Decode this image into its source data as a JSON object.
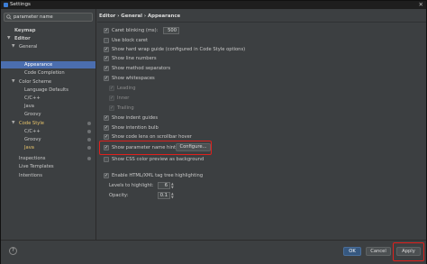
{
  "window": {
    "title": "Settings",
    "close_glyph": "✕"
  },
  "search": {
    "value": "parameter name"
  },
  "tree": [
    {
      "label": "Keymap",
      "bold": true
    },
    {
      "label": "Editor",
      "arrow": "▼",
      "bold": true
    },
    {
      "label": "General",
      "arrow": "▼"
    },
    {
      "label": "Appearance",
      "selected": true
    },
    {
      "label": "Code Completion"
    },
    {
      "label": "Color Scheme",
      "arrow": "▼"
    },
    {
      "label": "Language Defaults"
    },
    {
      "label": "C/C++"
    },
    {
      "label": "Java"
    },
    {
      "label": "Groovy"
    },
    {
      "label": "Code Style",
      "arrow": "▼",
      "highlight": true
    },
    {
      "label": "C/C++"
    },
    {
      "label": "Groovy"
    },
    {
      "label": "Java",
      "highlight": true
    },
    {
      "label": "Inspections"
    },
    {
      "label": "Live Templates"
    },
    {
      "label": "Intentions"
    }
  ],
  "breadcrumb": "Editor › General › Appearance",
  "settings": {
    "caret_blinking_label": "Caret blinking (ms):",
    "caret_blinking_value": "500",
    "use_block_caret": "Use block caret",
    "show_hard_wrap": "Show hard wrap guide (configured in Code Style options)",
    "show_line_numbers": "Show line numbers",
    "show_method_separators": "Show method separators",
    "show_whitespaces": "Show whitespaces",
    "leading": "Leading",
    "inner": "Inner",
    "trailing": "Trailing",
    "show_indent_guides": "Show indent guides",
    "show_intention_bulb": "Show intention bulb",
    "show_code_lens": "Show code lens on scrollbar hover",
    "show_param_hints": "Show parameter name hints",
    "configure_button": "Configure...",
    "show_css_color": "Show CSS color preview as background",
    "enable_html_xml": "Enable HTML/XML tag tree highlighting",
    "levels_label": "Levels to highlight:",
    "levels_value": "6",
    "opacity_label": "Opacity:",
    "opacity_value": "0.1"
  },
  "footer": {
    "help": "?",
    "ok": "OK",
    "cancel": "Cancel",
    "apply": "Apply"
  },
  "colors": {
    "selection": "#4b6eaf",
    "annotation": "#e0201c",
    "highlight": "#e8c46a"
  }
}
